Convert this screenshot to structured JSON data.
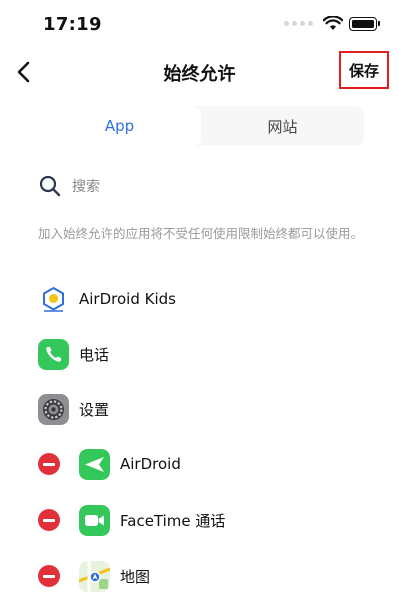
{
  "status_bar": {
    "time": "17:19"
  },
  "nav": {
    "title": "始终允许",
    "save_label": "保存"
  },
  "tabs": [
    {
      "label": "App",
      "active": true
    },
    {
      "label": "网站",
      "active": false
    }
  ],
  "search": {
    "placeholder": "搜索"
  },
  "description": "加入始终允许的应用将不受任何使用限制始终都可以使用。",
  "apps": {
    "fixed": [
      {
        "name": "AirDroid Kids",
        "icon": "airdroid-kids-icon"
      },
      {
        "name": "电话",
        "icon": "phone-icon"
      },
      {
        "name": "设置",
        "icon": "settings-icon"
      }
    ],
    "removable": [
      {
        "name": "AirDroid",
        "icon": "airdroid-icon"
      },
      {
        "name": "FaceTime 通话",
        "icon": "facetime-icon"
      },
      {
        "name": "地图",
        "icon": "maps-icon"
      }
    ]
  },
  "colors": {
    "accent": "#2f6fdc",
    "remove": "#e0303a",
    "highlight_border": "#e02020",
    "ios_green": "#34c759"
  }
}
